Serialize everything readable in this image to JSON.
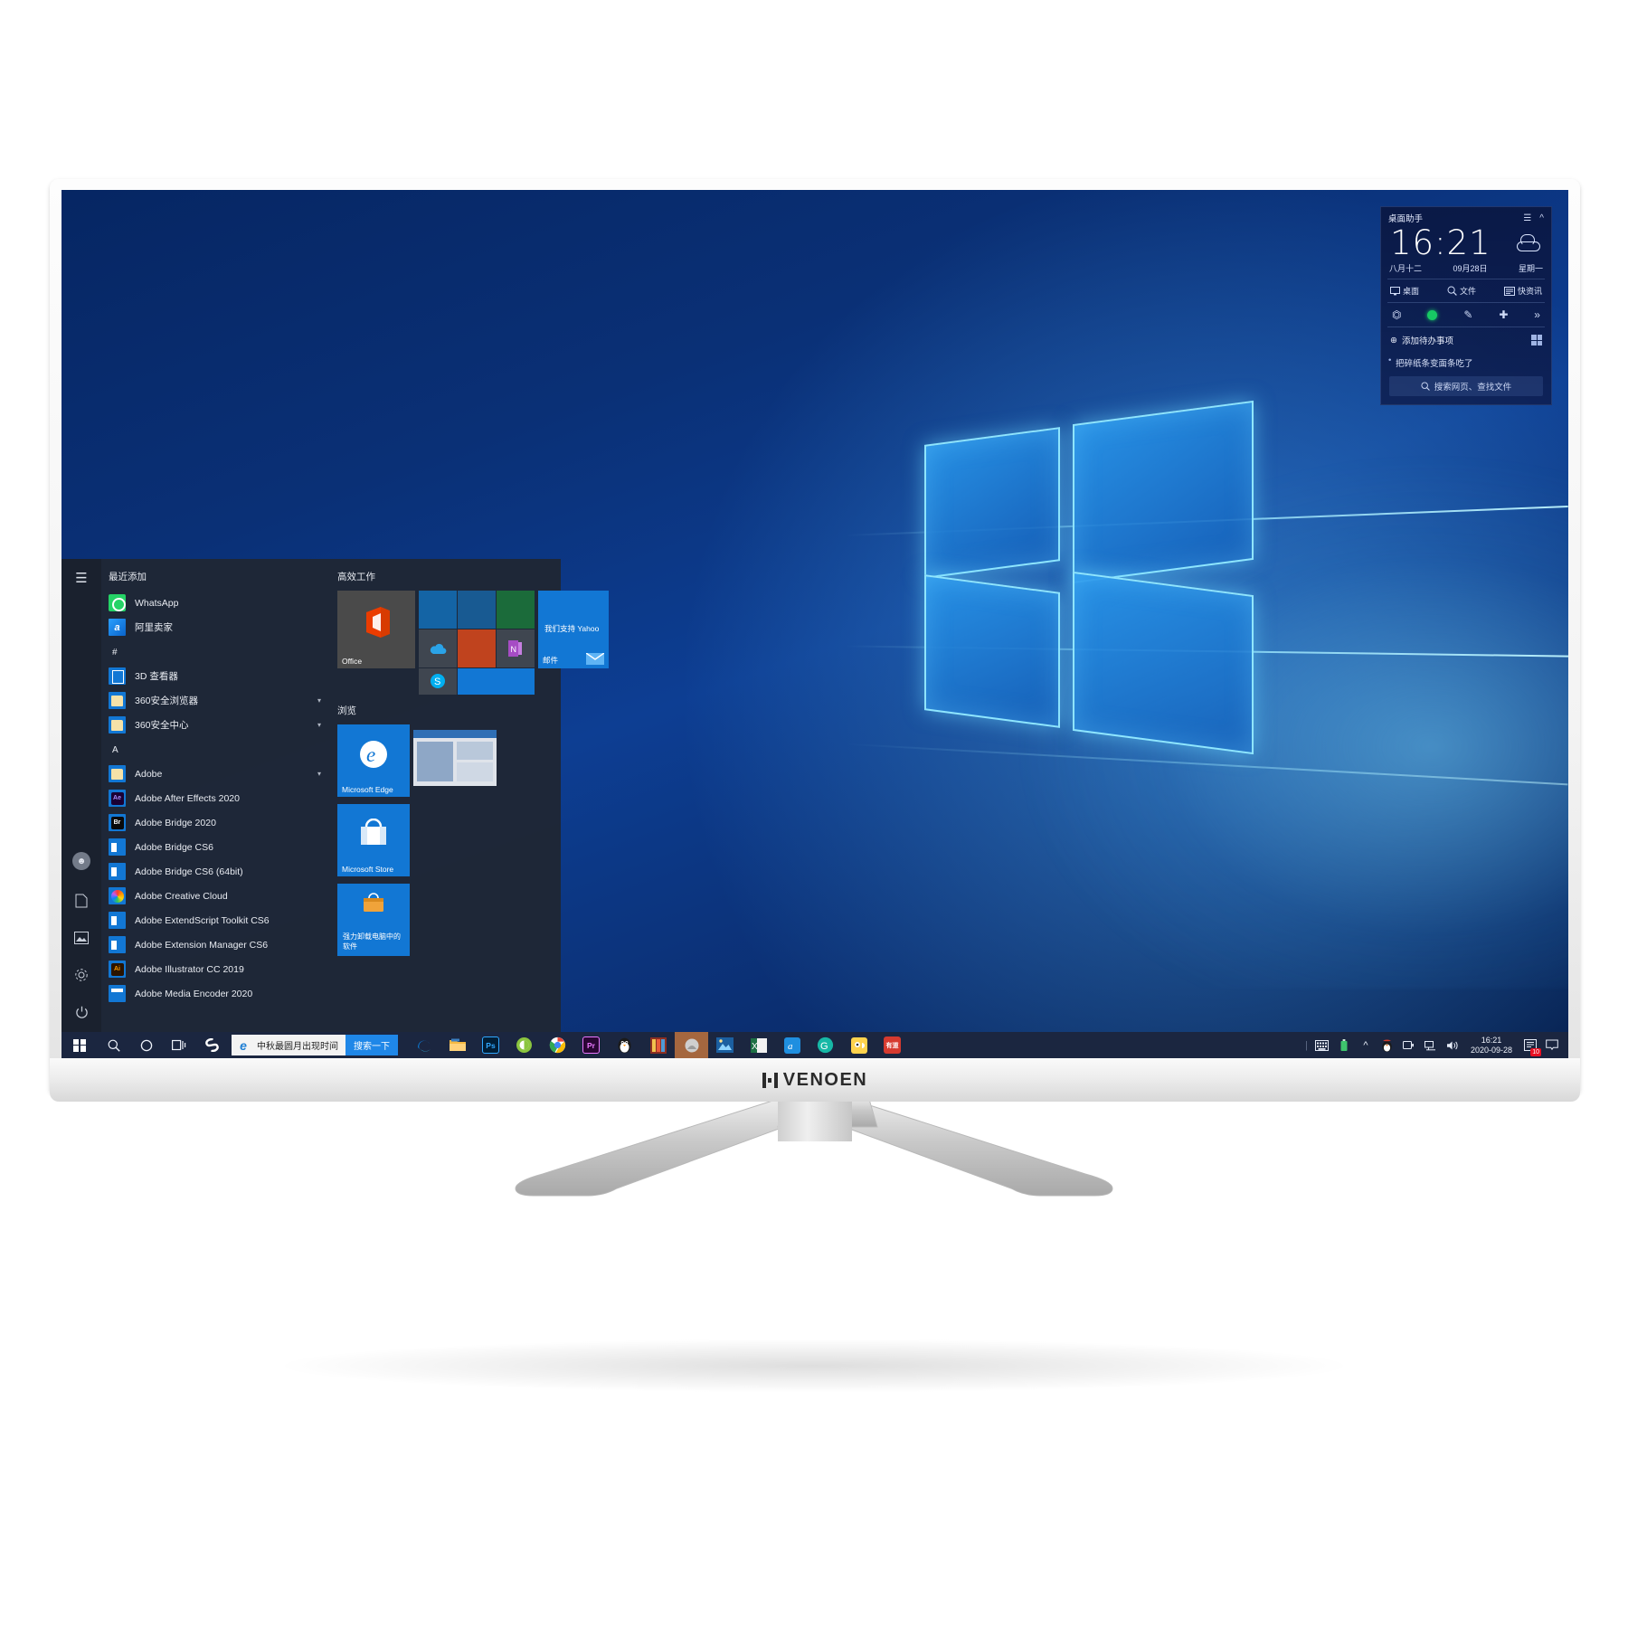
{
  "device": {
    "brand": "VENOEN"
  },
  "assistant": {
    "title": "桌面助手",
    "menu_icon": "hamburger-icon",
    "collapse_icon": "chevron-up-icon",
    "time": "16:21",
    "weather_icon": "cloud-icon",
    "lunar_date": "八月十二",
    "date": "09月28日",
    "weekday": "星期一",
    "nav": [
      {
        "icon": "monitor-icon",
        "label": "桌面"
      },
      {
        "icon": "search-icon",
        "label": "文件"
      },
      {
        "icon": "news-icon",
        "label": "快资讯"
      }
    ],
    "tools": [
      "crop-icon",
      "record-dot-icon",
      "note-icon",
      "add-plus-icon",
      "more-chevrons-icon"
    ],
    "todo_add": "添加待办事项",
    "todo_grid_icon": "grid-icon",
    "note": "把碎纸条变面条吃了",
    "search_placeholder": "搜索网页、查找文件",
    "search_icon": "search-icon"
  },
  "start_menu": {
    "rail": {
      "hamburger": "hamburger-icon",
      "items": [
        {
          "icon": "account-icon"
        },
        {
          "icon": "documents-icon"
        },
        {
          "icon": "pictures-icon"
        },
        {
          "icon": "settings-gear-icon"
        },
        {
          "icon": "power-icon"
        }
      ]
    },
    "recently_added_header": "最近添加",
    "recently_added": [
      {
        "name": "WhatsApp",
        "icon": "whatsapp-icon"
      },
      {
        "name": "阿里卖家",
        "icon": "alibaba-seller-icon"
      }
    ],
    "groups": [
      {
        "letter": "#",
        "apps": [
          {
            "name": "3D 查看器",
            "icon": "3d-viewer-icon",
            "expandable": false
          },
          {
            "name": "360安全浏览器",
            "icon": "folder-icon",
            "expandable": true
          },
          {
            "name": "360安全中心",
            "icon": "folder-icon",
            "expandable": true
          }
        ]
      },
      {
        "letter": "A",
        "apps": [
          {
            "name": "Adobe",
            "icon": "folder-icon",
            "expandable": true
          },
          {
            "name": "Adobe After Effects 2020",
            "icon": "after-effects-icon",
            "expandable": false
          },
          {
            "name": "Adobe Bridge 2020",
            "icon": "bridge-icon",
            "expandable": false
          },
          {
            "name": "Adobe Bridge CS6",
            "icon": "adobe-window-icon",
            "expandable": false
          },
          {
            "name": "Adobe Bridge CS6 (64bit)",
            "icon": "adobe-window-icon",
            "expandable": false
          },
          {
            "name": "Adobe Creative Cloud",
            "icon": "creative-cloud-icon",
            "expandable": false
          },
          {
            "name": "Adobe ExtendScript Toolkit CS6",
            "icon": "adobe-window-icon",
            "expandable": false
          },
          {
            "name": "Adobe Extension Manager CS6",
            "icon": "adobe-window-icon",
            "expandable": false
          },
          {
            "name": "Adobe Illustrator CC 2019",
            "icon": "illustrator-icon",
            "expandable": false
          },
          {
            "name": "Adobe Media Encoder 2020",
            "icon": "media-encoder-icon",
            "expandable": false
          }
        ]
      }
    ],
    "tile_groups": [
      {
        "title": "高效工作",
        "tiles": [
          {
            "label": "Office",
            "icon": "office-icon",
            "color": "#4a4a4a"
          },
          {
            "label": "",
            "icon": "onedrive-icon",
            "color": "#1464a5"
          },
          {
            "label": "",
            "icon": "onenote-icon",
            "color": "#c0431e"
          },
          {
            "label": "",
            "icon": "skype-icon",
            "color": "#1b8f4a"
          },
          {
            "label": "邮件",
            "icon": "mail-icon",
            "color": "#1277d4",
            "headline": "我们支持 Yahoo"
          }
        ]
      },
      {
        "title": "浏览",
        "tiles": [
          {
            "label": "Microsoft Edge",
            "icon": "edge-icon",
            "color": "#1277d4"
          },
          {
            "label": "",
            "icon": "screenshot-preview",
            "color": "#e8e8e8"
          },
          {
            "label": "Microsoft Store",
            "icon": "store-icon",
            "color": "#1277d4"
          },
          {
            "label": "强力卸载电脑中的软件",
            "icon": "uninstaller-icon",
            "color": "#1277d4"
          }
        ]
      }
    ]
  },
  "taskbar": {
    "start_icon": "windows-start-icon",
    "left_icons": [
      {
        "icon": "search-icon"
      },
      {
        "icon": "cortana-circle-icon"
      },
      {
        "icon": "task-view-icon"
      },
      {
        "icon": "sogou-icon"
      }
    ],
    "search_box": {
      "browser_icon": "edge-legacy-icon",
      "query": "中秋最圆月出现时间",
      "button_label": "搜索一下"
    },
    "pinned": [
      {
        "name": "edge",
        "icon": "edge-icon",
        "color": "#1b2640",
        "glyph": "e"
      },
      {
        "name": "file-explorer",
        "icon": "file-explorer-icon",
        "color": "#f0b429",
        "glyph": ""
      },
      {
        "name": "photoshop",
        "icon": "photoshop-icon",
        "color": "#001e36",
        "glyph": "Ps"
      },
      {
        "name": "chrome-green",
        "icon": "browser-green-icon",
        "color": "#7bc043",
        "glyph": ""
      },
      {
        "name": "chrome",
        "icon": "chrome-icon",
        "color": "#ffffff",
        "glyph": ""
      },
      {
        "name": "premiere",
        "icon": "premiere-icon",
        "color": "#2a0634",
        "glyph": "Pr"
      },
      {
        "name": "qq",
        "icon": "qq-penguin-icon",
        "color": "#1b2640",
        "glyph": ""
      },
      {
        "name": "winrar",
        "icon": "winrar-icon",
        "color": "#b93d2c",
        "glyph": ""
      },
      {
        "name": "active-app",
        "icon": "app-icon",
        "color": "#a5673f",
        "glyph": ""
      },
      {
        "name": "photo-viewer",
        "icon": "picture-icon",
        "color": "#1c4f8b",
        "glyph": ""
      },
      {
        "name": "excel",
        "icon": "excel-icon",
        "color": "#f2f2f2",
        "glyph": "X"
      },
      {
        "name": "aliwangwang",
        "icon": "aliwangwang-icon",
        "color": "#1f8fe0",
        "glyph": ""
      },
      {
        "name": "360-browser",
        "icon": "360-browser-icon",
        "color": "#18b6a4",
        "glyph": "G"
      },
      {
        "name": "sogou-pinyin",
        "icon": "sogou-app-icon",
        "color": "#ffd34d",
        "glyph": ""
      },
      {
        "name": "youdao",
        "icon": "youdao-icon",
        "color": "#d63a2f",
        "glyph": "有道"
      }
    ],
    "tray": {
      "divider": "|",
      "icons": [
        {
          "icon": "keyboard-icon"
        },
        {
          "icon": "usb-battery-icon"
        },
        {
          "icon": "show-hidden-icons-chevron"
        },
        {
          "icon": "qq-tray-icon"
        },
        {
          "icon": "battery-icon"
        },
        {
          "icon": "network-icon"
        },
        {
          "icon": "volume-icon"
        }
      ],
      "clock_time": "16:21",
      "clock_date": "2020-09-28",
      "notification_icon": "action-center-icon",
      "notification_count": "10",
      "show-desktop": "show-desktop-bar"
    }
  }
}
